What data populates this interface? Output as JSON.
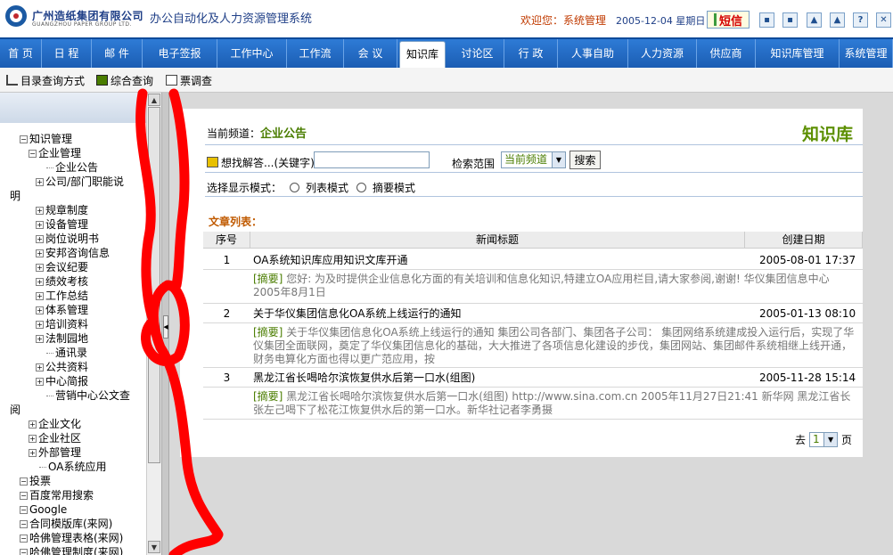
{
  "header": {
    "company_cn": "广州造纸集团有限公司",
    "company_en": "GUANGZHOU PAPER GROUP LTD.",
    "system_title": "办公自动化及人力资源管理系统",
    "welcome": "欢迎您：系统管理",
    "date": "2005-12-04 星期日",
    "message_label": "短信",
    "icons": [
      "lock-icon",
      "lock-icon",
      "user-icon",
      "user-icon",
      "help-icon",
      "close-icon",
      "exit-icon"
    ],
    "icon_glyphs": [
      "▪",
      "▪",
      "▲",
      "▲",
      "?",
      "✕",
      "↩"
    ]
  },
  "nav": {
    "items": [
      "首 页",
      "日 程",
      "邮 件",
      "电子签报",
      "工作中心",
      "工作流",
      "会 议",
      "知识库",
      "讨论区",
      "行 政",
      "人事自助",
      "人力资源",
      "供应商",
      "知识库管理",
      "系统管理"
    ],
    "active": "知识库"
  },
  "toolbar": {
    "items": [
      "目录查询方式",
      "综合查询",
      "票调查"
    ]
  },
  "sidebar": {
    "tree": [
      {
        "label": "知识管理",
        "toggle": "−"
      },
      {
        "label": "企业管理",
        "toggle": "−"
      },
      {
        "label": "企业公告",
        "toggle": ""
      },
      {
        "label": "公司/部门职能说",
        "toggle": "+"
      },
      {
        "label": "明",
        "toggle": ""
      },
      {
        "label": "规章制度",
        "toggle": "+"
      },
      {
        "label": "设备管理",
        "toggle": "+"
      },
      {
        "label": "岗位说明书",
        "toggle": "+"
      },
      {
        "label": "安邦咨询信息",
        "toggle": "+"
      },
      {
        "label": "会议纪要",
        "toggle": "+"
      },
      {
        "label": "绩效考核",
        "toggle": "+"
      },
      {
        "label": "工作总结",
        "toggle": "+"
      },
      {
        "label": "体系管理",
        "toggle": "+"
      },
      {
        "label": "培训资料",
        "toggle": "+"
      },
      {
        "label": "法制园地",
        "toggle": "+"
      },
      {
        "label": "通讯录",
        "toggle": ""
      },
      {
        "label": "公共资料",
        "toggle": "+"
      },
      {
        "label": "中心简报",
        "toggle": "+"
      },
      {
        "label": "营销中心公文查",
        "toggle": ""
      },
      {
        "label": "阅",
        "toggle": ""
      },
      {
        "label": "企业文化",
        "toggle": "+"
      },
      {
        "label": "企业社区",
        "toggle": "+"
      },
      {
        "label": "外部管理",
        "toggle": "+"
      },
      {
        "label": "OA系统应用",
        "toggle": ""
      },
      {
        "label": "投票",
        "toggle": "−"
      },
      {
        "label": "百度常用搜索",
        "toggle": "−"
      },
      {
        "label": "Google",
        "toggle": "−"
      },
      {
        "label": "合同模版库(来网)",
        "toggle": "−"
      },
      {
        "label": "哈佛管理表格(来网)",
        "toggle": "−"
      },
      {
        "label": "哈佛管理制度(来网)",
        "toggle": "−"
      }
    ]
  },
  "main": {
    "channel_label": "当前频道：",
    "channel_value": "企业公告",
    "kb_title": "知识库",
    "search_label": "想找解答...(关键字)",
    "search_value": "",
    "scope_label": "检索范围",
    "scope_value": "当前频道",
    "search_button": "搜索",
    "mode_label": "选择显示模式：",
    "mode_list": "列表模式",
    "mode_summary": "摘要模式",
    "article_list_title": "文章列表：",
    "columns": [
      "序号",
      "新闻标题",
      "创建日期"
    ],
    "summary_tag": "[摘要]",
    "rows": [
      {
        "no": "1",
        "title": "OA系统知识库应用知识文库开通",
        "date": "2005-08-01 17:37",
        "summary": "您好: 为及时提供企业信息化方面的有关培训和信息化知识,特建立OA应用栏目,请大家参阅,谢谢! 华仪集团信息中心 2005年8月1日"
      },
      {
        "no": "2",
        "title": "关于华仪集团信息化OA系统上线运行的通知",
        "date": "2005-01-13 08:10",
        "summary": "关于华仪集团信息化OA系统上线运行的通知 集团公司各部门、集团各子公司： 集团网络系统建成投入运行后，实现了华仪集团全面联网，奠定了华仪集团信息化的基础，大大推进了各项信息化建设的步伐，集团网站、集团邮件系统相继上线开通，财务电算化方面也得以更广范应用，按"
      },
      {
        "no": "3",
        "title": "黑龙江省长喝哈尔滨恢复供水后第一口水(组图)",
        "date": "2005-11-28 15:14",
        "summary": "黑龙江省长喝哈尔滨恢复供水后第一口水(组图) http://www.sina.com.cn 2005年11月27日21:41 新华网 黑龙江省长张左己喝下了松花江恢复供水后的第一口水。新华社记者李勇摄"
      }
    ],
    "pager_prefix": "去",
    "pager_value": "1",
    "pager_suffix": "页"
  },
  "colors": {
    "nav_blue": "#1b5db3",
    "accent_green": "#5c8f00",
    "list_title_orange": "#c05a00",
    "annotation_red": "#ff0000"
  }
}
